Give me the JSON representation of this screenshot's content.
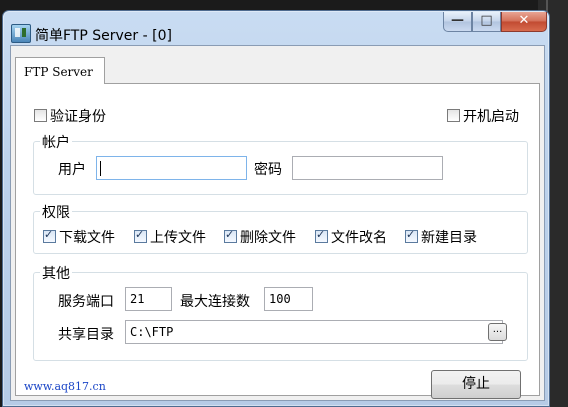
{
  "window": {
    "title": "简单FTP Server - [0]",
    "controls": {
      "minimize": "—",
      "maximize": "□",
      "close": "✕"
    }
  },
  "tab": {
    "label": "FTP Server"
  },
  "auth": {
    "label": "验证身份",
    "checked": false
  },
  "autostart": {
    "label": "开机启动",
    "checked": false
  },
  "account": {
    "title": "帐户",
    "user_label": "用户",
    "user_value": "",
    "password_label": "密码",
    "password_value": ""
  },
  "permissions": {
    "title": "权限",
    "items": [
      {
        "label": "下载文件",
        "checked": true
      },
      {
        "label": "上传文件",
        "checked": true
      },
      {
        "label": "删除文件",
        "checked": true
      },
      {
        "label": "文件改名",
        "checked": true
      },
      {
        "label": "新建目录",
        "checked": true
      }
    ]
  },
  "other": {
    "title": "其他",
    "port_label": "服务端口",
    "port_value": "21",
    "maxconn_label": "最大连接数",
    "maxconn_value": "100",
    "share_label": "共享目录",
    "share_value": "C:\\FTP",
    "browse_label": "..."
  },
  "footer": {
    "link": "www.aq817.cn",
    "stop_label": "停止"
  }
}
